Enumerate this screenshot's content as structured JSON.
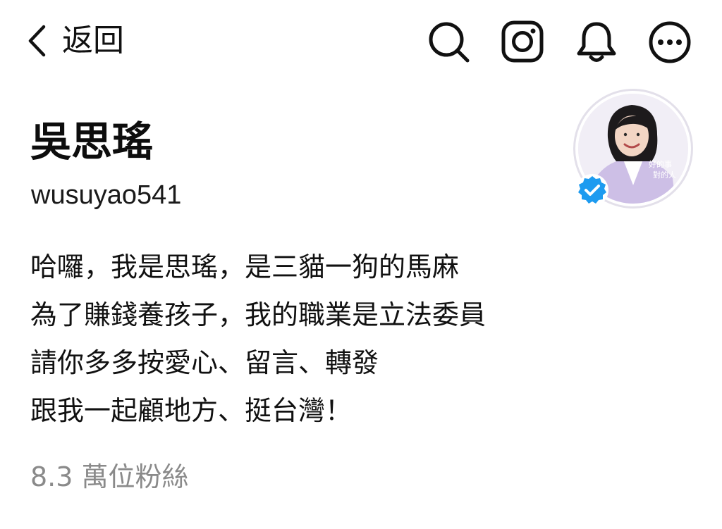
{
  "header": {
    "back_label": "返回",
    "icons": {
      "back": "chevron-left-icon",
      "search": "search-icon",
      "instagram": "instagram-icon",
      "notifications": "bell-icon",
      "more": "more-options-icon"
    }
  },
  "profile": {
    "display_name": "吳思瑤",
    "username": "wusuyao541",
    "verified": true,
    "avatar_overlay_text": [
      "好的事",
      "對的人"
    ],
    "bio_lines": [
      "哈囉，我是思瑤，是三貓一狗的馬麻",
      "為了賺錢養孩子，我的職業是立法委員",
      "請你多多按愛心、留言、轉發",
      "跟我一起顧地方、挺台灣！"
    ],
    "followers_text": "8.3 萬位粉絲"
  },
  "colors": {
    "text": "#111111",
    "muted": "#8a8a8a",
    "verified_blue": "#1d9bf0",
    "avatar_bg": "#f1eef6",
    "avatar_accent": "#cdbfe6"
  }
}
